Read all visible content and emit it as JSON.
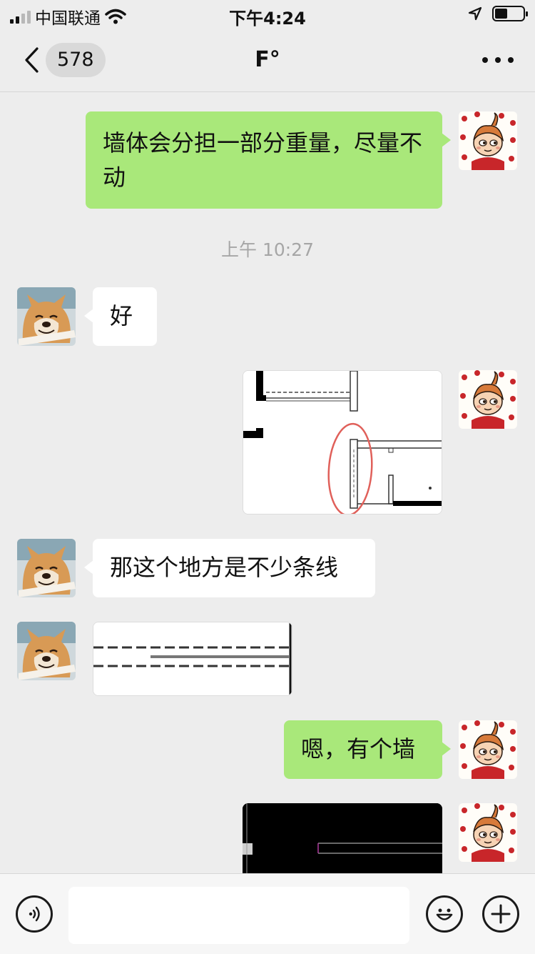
{
  "status_bar": {
    "carrier": "中国联通",
    "time": "下午4:24",
    "signal_bars": 2,
    "battery_level": 0.45,
    "icons": [
      "signal-icon",
      "wifi-icon",
      "location-arrow-icon",
      "battery-icon"
    ]
  },
  "nav": {
    "back_icon": "chevron-left-icon",
    "unread_count": "578",
    "title": "F°",
    "more_icon": "more-dots-icon"
  },
  "messages": [
    {
      "side": "self",
      "type": "text",
      "text": "墙体会分担一部分重量，尽量不动"
    },
    {
      "type": "time",
      "text": "上午 10:27"
    },
    {
      "side": "other",
      "type": "text",
      "text": "好"
    },
    {
      "side": "self",
      "type": "image",
      "content": "floor-plan-sketch-with-red-circle"
    },
    {
      "side": "other",
      "type": "text",
      "text": "那这个地方是不少条线"
    },
    {
      "side": "other",
      "type": "image",
      "content": "dashed-lines-crop"
    },
    {
      "side": "self",
      "type": "text",
      "text": "嗯，有个墙"
    },
    {
      "side": "self",
      "type": "image",
      "content": "dark-cad-screenshot"
    }
  ],
  "input_bar": {
    "voice_icon": "voice-icon",
    "input_value": "",
    "emoji_icon": "emoji-icon",
    "plus_icon": "plus-icon"
  },
  "colors": {
    "background": "#ededed",
    "self_bubble": "#a9e87a",
    "other_bubble": "#ffffff",
    "time_text": "#a6a6a6",
    "circle_annotation": "#e0605a"
  }
}
